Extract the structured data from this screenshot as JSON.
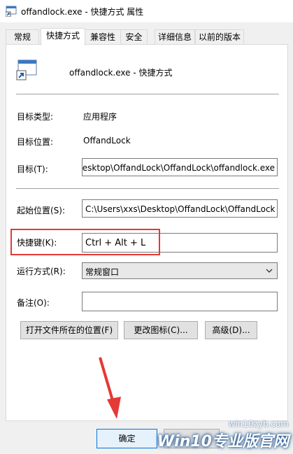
{
  "window": {
    "title": "offandlock.exe - 快捷方式 属性",
    "icon": "shortcut-app-icon"
  },
  "tabs": [
    {
      "label": "常规"
    },
    {
      "label": "快捷方式"
    },
    {
      "label": "兼容性"
    },
    {
      "label": "安全"
    },
    {
      "label": "详细信息"
    },
    {
      "label": "以前的版本"
    }
  ],
  "header": {
    "name": "offandlock.exe - 快捷方式"
  },
  "fields": {
    "target_type_label": "目标类型:",
    "target_type_value": "应用程序",
    "target_location_label": "目标位置:",
    "target_location_value": "OffandLock",
    "target_label": "目标(T):",
    "target_value": "esktop\\OffandLock\\OffandLock\\offandlock.exe",
    "start_in_label": "起始位置(S):",
    "start_in_value": "C:\\Users\\xxs\\Desktop\\OffandLock\\OffandLock",
    "shortcut_key_label": "快捷键(K):",
    "shortcut_key_value": "Ctrl + Alt + L",
    "run_label": "运行方式(R):",
    "run_value": "常规窗口",
    "comment_label": "备注(O):",
    "comment_value": ""
  },
  "buttons": {
    "open_location": "打开文件所在的位置(F)",
    "change_icon": "更改图标(C)...",
    "advanced": "高级(D)...",
    "ok": "确定"
  },
  "watermark": {
    "url": "win10zyb.com",
    "brand": "Win10专业版官网"
  },
  "colors": {
    "highlight": "#e53935",
    "arrow": "#e53935"
  }
}
